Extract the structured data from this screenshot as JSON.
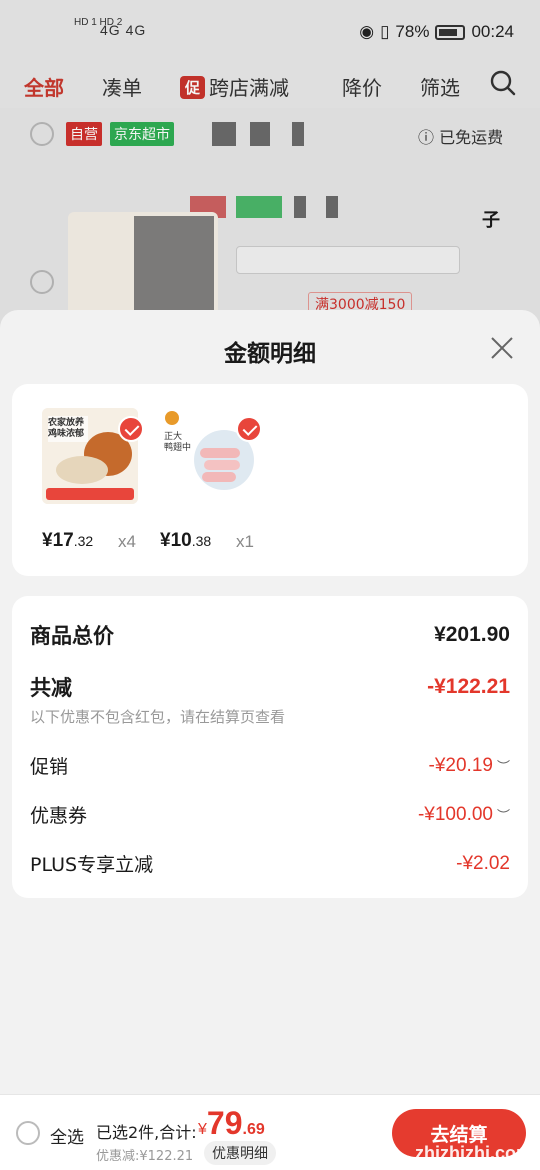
{
  "status_bar": {
    "sim_labels": "HD 1 HD 2",
    "signal": "4G 4G",
    "battery": "78%",
    "time": "00:24"
  },
  "tabs": [
    {
      "label": "全部"
    },
    {
      "label": "凑单"
    },
    {
      "label": "跨店满减",
      "tag": "促"
    },
    {
      "label": "降价"
    },
    {
      "label": "筛选"
    }
  ],
  "background_list": {
    "chip_self": "自营",
    "chip_store": "京东超市",
    "free_shipping": "已免运费",
    "promo_tag": "满3000减150",
    "fragment": "子"
  },
  "sheet": {
    "title": "金额明细",
    "items": [
      {
        "price_int": "¥17",
        "price_dec": ".32",
        "qty": "x4",
        "thumb_text": "农家放养 鸡味浓郁"
      },
      {
        "price_int": "¥10",
        "price_dec": ".38",
        "qty": "x1",
        "thumb_text": "正大 鸭翅中"
      }
    ],
    "summary": {
      "total_label": "商品总价",
      "total_value": "¥201.90",
      "reduce_label": "共减",
      "reduce_value": "-¥122.21",
      "note": "以下优惠不包含红包，请在结算页查看",
      "rows": [
        {
          "label": "促销",
          "value": "-¥20.19"
        },
        {
          "label": "优惠券",
          "value": "-¥100.00"
        },
        {
          "label": "PLUS专享立减",
          "value": "-¥2.02"
        }
      ]
    }
  },
  "bottom_bar": {
    "select_all": "全选",
    "selected_info": "已选2件,合计:",
    "total_cur": "¥",
    "total_int": "79",
    "total_dec": ".69",
    "discount": "优惠减:¥122.21",
    "detail_button": "优惠明细",
    "checkout": "去结算",
    "watermark": "zhizhizhi.com"
  },
  "colors": {
    "accent": "#e3372b",
    "background": "#f2f2f2"
  }
}
